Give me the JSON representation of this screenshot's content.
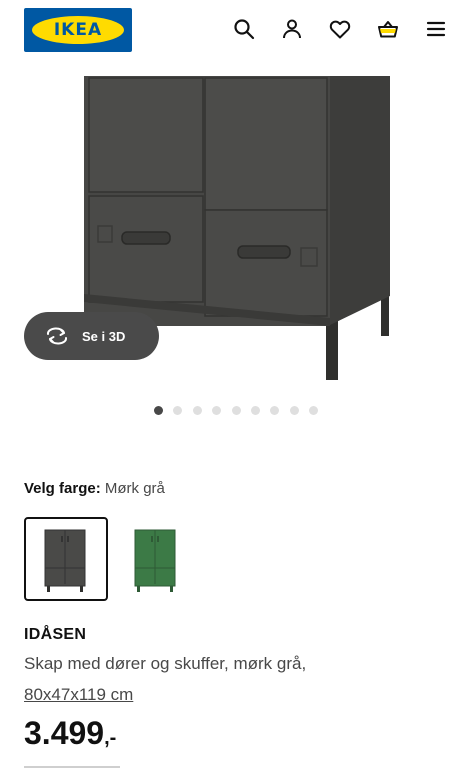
{
  "header": {
    "logo_text": "IKEA",
    "icons": [
      "search-icon",
      "account-icon",
      "heart-icon",
      "basket-icon",
      "menu-icon"
    ],
    "basket_accent": "#ffdb00",
    "brand_blue": "#0058a3"
  },
  "gallery": {
    "view_3d_label": "Se i 3D",
    "dots_total": 9,
    "dots_active_index": 0
  },
  "color_selector": {
    "label": "Velg farge:",
    "selected_value": "Mørk grå",
    "options": [
      {
        "name": "Mørk grå",
        "color": "#4a4a48",
        "selected": true
      },
      {
        "name": "Grønn",
        "color": "#3c7a46",
        "selected": false
      }
    ]
  },
  "product": {
    "name": "IDÅSEN",
    "description": "Skap med dører og skuffer, mørk grå,",
    "size": "80x47x119 cm",
    "price_main": "3.499",
    "price_suffix": ",-"
  }
}
